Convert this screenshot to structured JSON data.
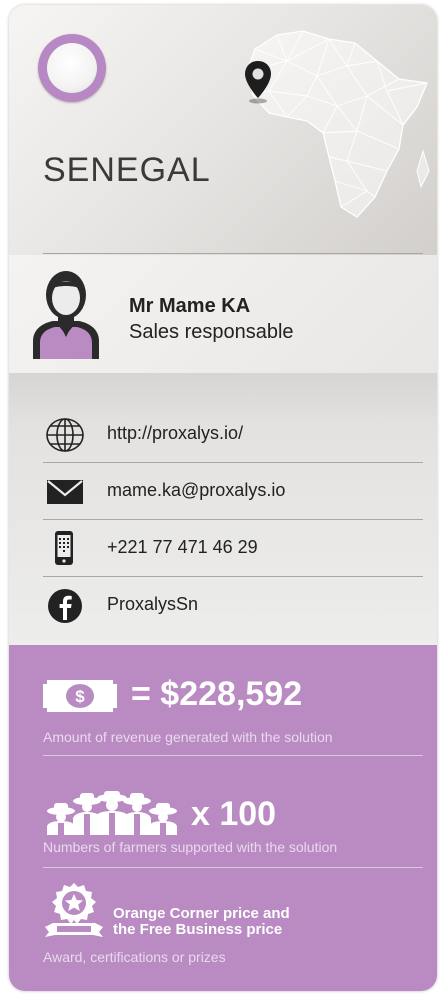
{
  "header": {
    "country": "SENEGAL",
    "flag_icon": "flag-circle-icon",
    "map_icon": "africa-map-icon",
    "pin_icon": "location-pin-icon"
  },
  "contact_person": {
    "name": "Mr Mame KA",
    "role": "Sales responsable",
    "avatar_icon": "person-avatar-icon"
  },
  "contacts": [
    {
      "icon": "globe-icon",
      "text": "http://proxalys.io/"
    },
    {
      "icon": "mail-icon",
      "text": "mame.ka@proxalys.io"
    },
    {
      "icon": "phone-icon",
      "text": "+221 77 471 46 29"
    },
    {
      "icon": "facebook-icon",
      "text": "ProxalysSn"
    }
  ],
  "stats": {
    "revenue": {
      "icon": "money-icon",
      "value": "= $228,592",
      "caption": "Amount of revenue generated with the solution"
    },
    "farmers": {
      "icon": "farmers-group-icon",
      "value": "x 100",
      "caption": "Numbers of farmers supported with the solution"
    },
    "awards": {
      "icon": "award-badge-icon",
      "line1": "Orange Corner price and",
      "line2": "the Free Business price",
      "caption": "Award, certifications or prizes"
    }
  },
  "colors": {
    "accent_purple": "#b98bc2",
    "text_dark": "#222222"
  }
}
